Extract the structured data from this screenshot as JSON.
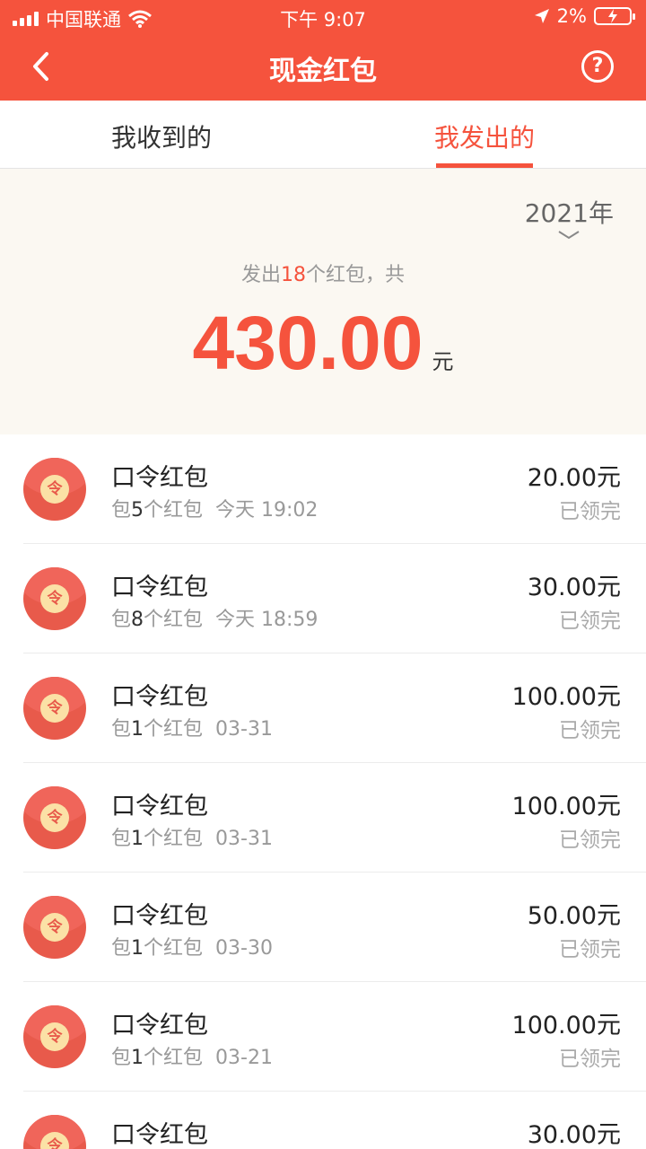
{
  "status_bar": {
    "carrier": "中国联通",
    "time": "下午 9:07",
    "battery": "2%"
  },
  "nav": {
    "title": "现金红包",
    "help": "?"
  },
  "tabs": {
    "received": "我收到的",
    "sent": "我发出的"
  },
  "summary": {
    "year": "2021年",
    "prefix": "发出",
    "count": "18",
    "suffix": "个红包，共",
    "total": "430.00",
    "unit": "元"
  },
  "items": [
    {
      "title": "口令红包",
      "prefix": "包",
      "num": "5",
      "suffix": "个红包",
      "time": "今天 19:02",
      "amount": "20.00元",
      "status": "已领完"
    },
    {
      "title": "口令红包",
      "prefix": "包",
      "num": "8",
      "suffix": "个红包",
      "time": "今天 18:59",
      "amount": "30.00元",
      "status": "已领完"
    },
    {
      "title": "口令红包",
      "prefix": "包",
      "num": "1",
      "suffix": "个红包",
      "time": "03-31",
      "amount": "100.00元",
      "status": "已领完"
    },
    {
      "title": "口令红包",
      "prefix": "包",
      "num": "1",
      "suffix": "个红包",
      "time": "03-31",
      "amount": "100.00元",
      "status": "已领完"
    },
    {
      "title": "口令红包",
      "prefix": "包",
      "num": "1",
      "suffix": "个红包",
      "time": "03-30",
      "amount": "50.00元",
      "status": "已领完"
    },
    {
      "title": "口令红包",
      "prefix": "包",
      "num": "1",
      "suffix": "个红包",
      "time": "03-21",
      "amount": "100.00元",
      "status": "已领完"
    },
    {
      "title": "口令红包",
      "prefix": "",
      "num": "",
      "suffix": "",
      "time": "",
      "amount": "30.00元",
      "status": ""
    }
  ],
  "seal_char": "令",
  "colors": {
    "accent": "#f5533d",
    "summary_bg": "#fbf8f2",
    "envelope": "#e85a4b",
    "seal": "#fbe1a6"
  },
  "icons": [
    "signal-icon",
    "wifi-icon",
    "location-arrow-icon",
    "battery-icon",
    "back-arrow-icon",
    "help-icon",
    "chevron-down-icon",
    "red-envelope-icon"
  ]
}
